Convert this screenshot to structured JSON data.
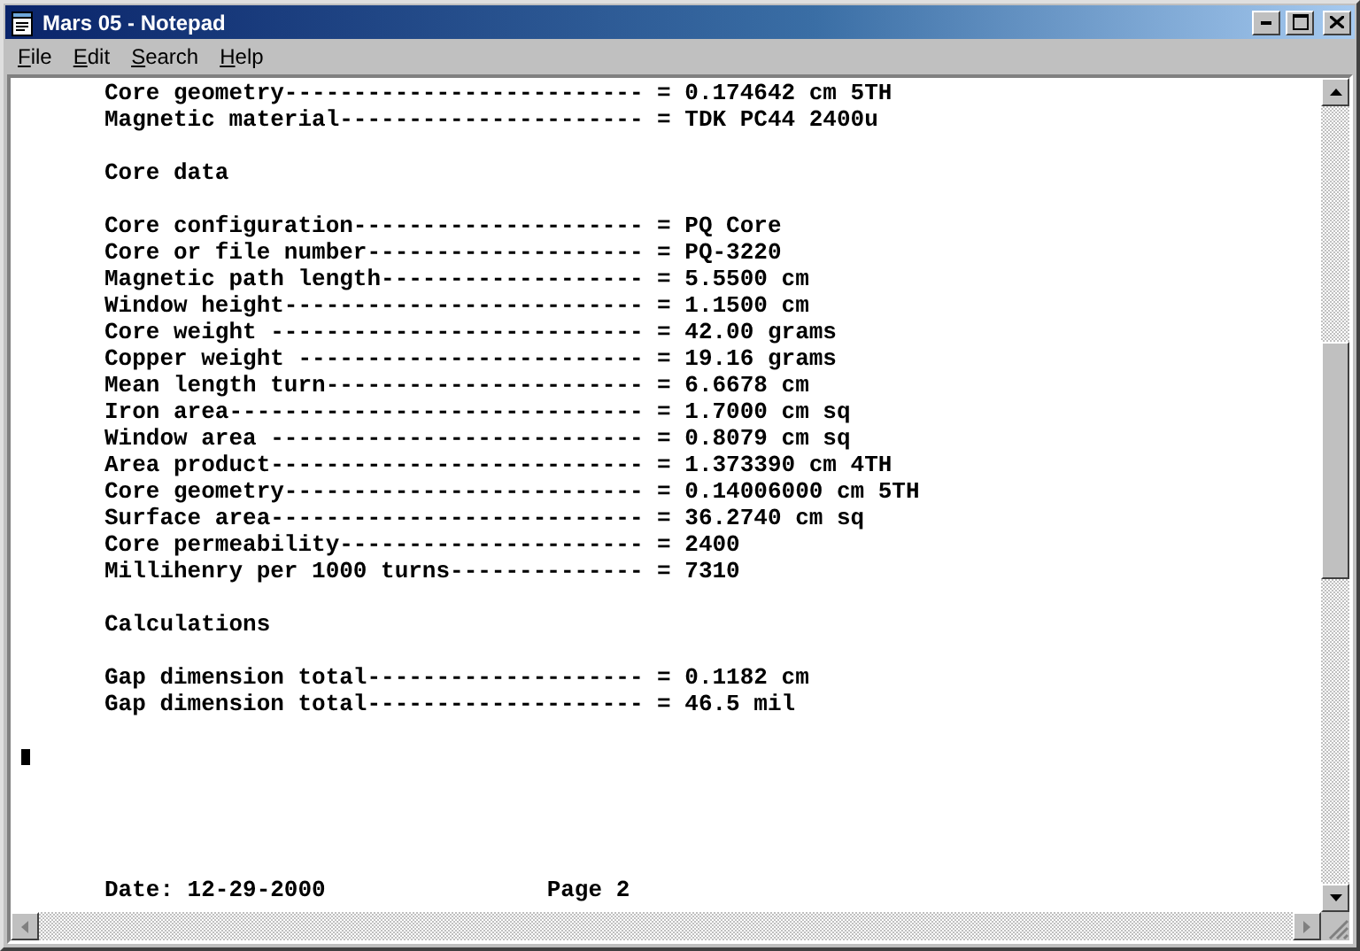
{
  "window": {
    "title": "Mars 05 - Notepad"
  },
  "menu": [
    {
      "label": "File"
    },
    {
      "label": "Edit"
    },
    {
      "label": "Search"
    },
    {
      "label": "Help"
    }
  ],
  "lines": [
    {
      "kind": "text",
      "text": "Core geometry-------------------------- = 0.174642 cm 5TH"
    },
    {
      "kind": "text",
      "text": "Magnetic material---------------------- = TDK PC44 2400u"
    },
    {
      "kind": "blank"
    },
    {
      "kind": "text",
      "text": "Core data"
    },
    {
      "kind": "blank"
    },
    {
      "kind": "text",
      "text": "Core configuration--------------------- = PQ Core"
    },
    {
      "kind": "text",
      "text": "Core or file number-------------------- = PQ-3220"
    },
    {
      "kind": "text",
      "text": "Magnetic path length------------------- = 5.5500 cm"
    },
    {
      "kind": "text",
      "text": "Window height-------------------------- = 1.1500 cm"
    },
    {
      "kind": "text",
      "text": "Core weight --------------------------- = 42.00 grams"
    },
    {
      "kind": "text",
      "text": "Copper weight ------------------------- = 19.16 grams"
    },
    {
      "kind": "text",
      "text": "Mean length turn----------------------- = 6.6678 cm"
    },
    {
      "kind": "text",
      "text": "Iron area------------------------------ = 1.7000 cm sq"
    },
    {
      "kind": "text",
      "text": "Window area --------------------------- = 0.8079 cm sq"
    },
    {
      "kind": "text",
      "text": "Area product--------------------------- = 1.373390 cm 4TH"
    },
    {
      "kind": "text",
      "text": "Core geometry-------------------------- = 0.14006000 cm 5TH"
    },
    {
      "kind": "text",
      "text": "Surface area--------------------------- = 36.2740 cm sq"
    },
    {
      "kind": "text",
      "text": "Core permeability---------------------- = 2400"
    },
    {
      "kind": "text",
      "text": "Millihenry per 1000 turns-------------- = 7310"
    },
    {
      "kind": "blank"
    },
    {
      "kind": "text",
      "text": "Calculations"
    },
    {
      "kind": "blank"
    },
    {
      "kind": "text",
      "text": "Gap dimension total-------------------- = 0.1182 cm"
    },
    {
      "kind": "text",
      "text": "Gap dimension total-------------------- = 46.5 mil"
    },
    {
      "kind": "blank"
    },
    {
      "kind": "cursor"
    },
    {
      "kind": "blank"
    },
    {
      "kind": "blank"
    },
    {
      "kind": "blank"
    },
    {
      "kind": "blank"
    },
    {
      "kind": "footer",
      "date": "Date: 12-29-2000",
      "page": "Page 2"
    }
  ]
}
